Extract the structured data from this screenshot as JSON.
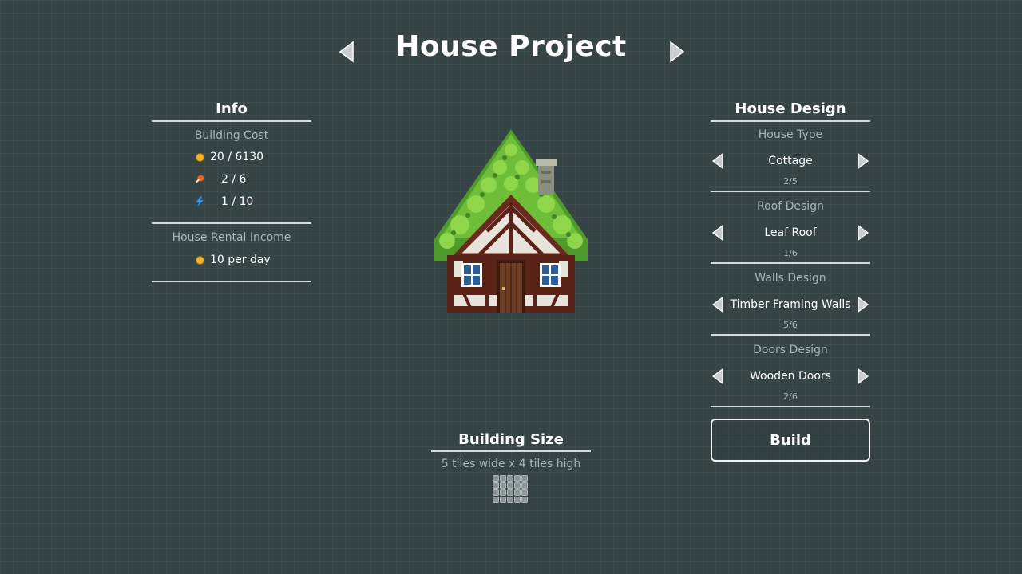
{
  "header": {
    "title": "House Project"
  },
  "info": {
    "title": "Info",
    "building_cost_label": "Building Cost",
    "costs": [
      {
        "icon": "coin-icon",
        "text": "20 / 6130"
      },
      {
        "icon": "meat-icon",
        "text": "2 / 6"
      },
      {
        "icon": "lightning-icon",
        "text": "1 / 10"
      }
    ],
    "rental_label": "House Rental Income",
    "rental_value": "10 per day"
  },
  "design": {
    "title": "House Design",
    "options": [
      {
        "label": "House Type",
        "value": "Cottage",
        "count": "2/5"
      },
      {
        "label": "Roof Design",
        "value": "Leaf Roof",
        "count": "1/6"
      },
      {
        "label": "Walls Design",
        "value": "Timber Framing Walls",
        "count": "5/6"
      },
      {
        "label": "Doors Design",
        "value": "Wooden Doors",
        "count": "2/6"
      }
    ],
    "build_label": "Build"
  },
  "size": {
    "title": "Building Size",
    "description": "5 tiles wide x 4 tiles high",
    "cols": 5,
    "rows": 4
  },
  "colors": {
    "background": "#364446",
    "text": "#ffffff",
    "muted": "#a9b6b7",
    "coin": "#f0b52a",
    "leaf": "#6fbe3a",
    "timber": "#5b2318"
  }
}
